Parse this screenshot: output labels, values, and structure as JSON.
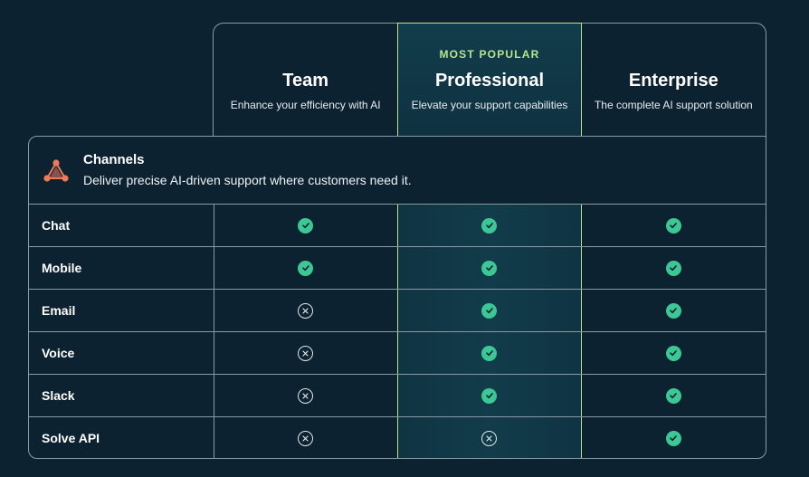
{
  "plans": [
    {
      "name": "Team",
      "description": "Enhance your efficiency with AI",
      "badge": ""
    },
    {
      "name": "Professional",
      "description": "Elevate your support capabilities",
      "badge": "MOST POPULAR"
    },
    {
      "name": "Enterprise",
      "description": "The complete AI support solution",
      "badge": ""
    }
  ],
  "section": {
    "title": "Channels",
    "description": "Deliver precise AI-driven support where customers need it.",
    "icon": "channels-triangle-icon"
  },
  "features": [
    {
      "label": "Chat",
      "availability": [
        true,
        true,
        true
      ]
    },
    {
      "label": "Mobile",
      "availability": [
        true,
        true,
        true
      ]
    },
    {
      "label": "Email",
      "availability": [
        false,
        true,
        true
      ]
    },
    {
      "label": "Voice",
      "availability": [
        false,
        true,
        true
      ]
    },
    {
      "label": "Slack",
      "availability": [
        false,
        true,
        true
      ]
    },
    {
      "label": "Solve API",
      "availability": [
        false,
        false,
        true
      ]
    }
  ],
  "colors": {
    "background": "#0c2230",
    "accent": "#b9e588",
    "check": "#3cc795",
    "icon": "#f07a5a"
  },
  "icons": {
    "included": "check-circle-icon",
    "excluded": "x-circle-icon"
  }
}
